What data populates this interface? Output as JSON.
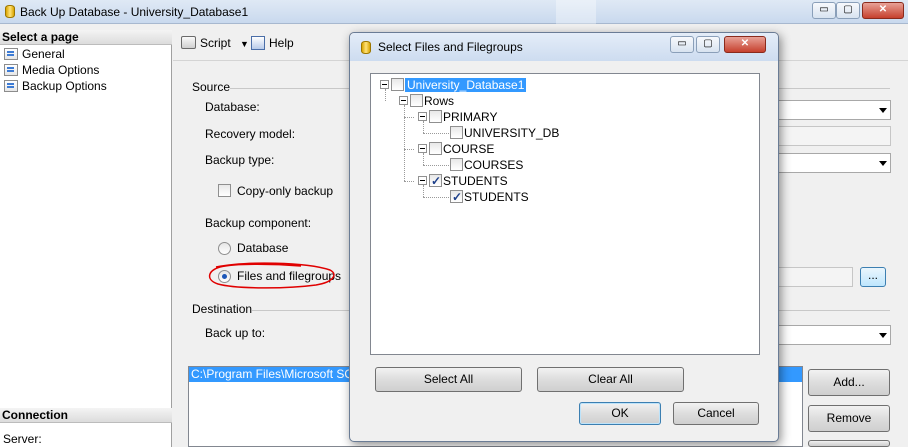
{
  "window": {
    "title": "Back Up Database - University_Database1",
    "minimize": "▭",
    "maximize": "▢",
    "close": "✕"
  },
  "left_pane": {
    "select_page_header": "Select a page",
    "pages": [
      {
        "label": "General"
      },
      {
        "label": "Media Options"
      },
      {
        "label": "Backup Options"
      }
    ],
    "connection_header": "Connection",
    "server_label": "Server:"
  },
  "toolbar": {
    "script_label": "Script",
    "help_label": "Help"
  },
  "main": {
    "source_label": "Source",
    "database_label": "Database:",
    "recovery_model_label": "Recovery model:",
    "backup_type_label": "Backup type:",
    "copy_only_label": "Copy-only backup",
    "backup_component_label": "Backup component:",
    "database_radio_label": "Database",
    "files_radio_label": "Files and filegroups",
    "files_browse_label": "...",
    "destination_label": "Destination",
    "backup_to_label": "Back up to:",
    "destination_path": "C:\\Program Files\\Microsoft SQL S",
    "add_button": "Add...",
    "remove_button": "Remove"
  },
  "dialog": {
    "title": "Select Files and Filegroups",
    "tree": {
      "database": "University_Database1",
      "rows": "Rows",
      "primary": "PRIMARY",
      "university_db": "UNIVERSITY_DB",
      "course": "COURSE",
      "courses": "COURSES",
      "students_group": "STUDENTS",
      "students_file": "STUDENTS"
    },
    "select_all": "Select All",
    "clear_all": "Clear All",
    "ok": "OK",
    "cancel": "Cancel"
  },
  "colors": {
    "selection": "#3399ff",
    "annotation_circle": "#e00000"
  }
}
